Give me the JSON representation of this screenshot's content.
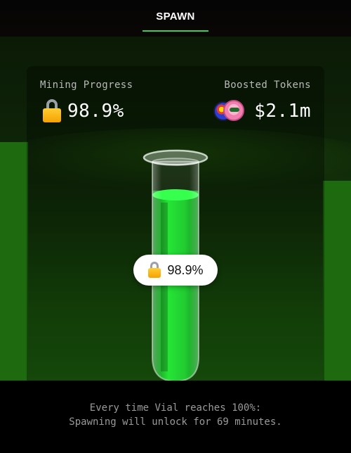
{
  "header": {
    "tabs": [
      {
        "label": "SPAWN",
        "active": true
      }
    ],
    "accent_color": "#34d058"
  },
  "stats": {
    "mining_progress": {
      "label": "Mining Progress",
      "value": "98.9%",
      "icon": "lock-icon"
    },
    "boosted_tokens": {
      "label": "Boosted Tokens",
      "value": "$2.1m",
      "icons": [
        "token-coin-icon",
        "pepe-token-icon"
      ]
    }
  },
  "vial": {
    "fill_fraction": 0.989,
    "liquid_color": "#19e32b",
    "badge": {
      "value": "98.9%",
      "icon": "lock-icon"
    }
  },
  "footer": {
    "line1": "Every time Vial reaches 100%:",
    "line2": "Spawning will unlock for 69 minutes."
  }
}
